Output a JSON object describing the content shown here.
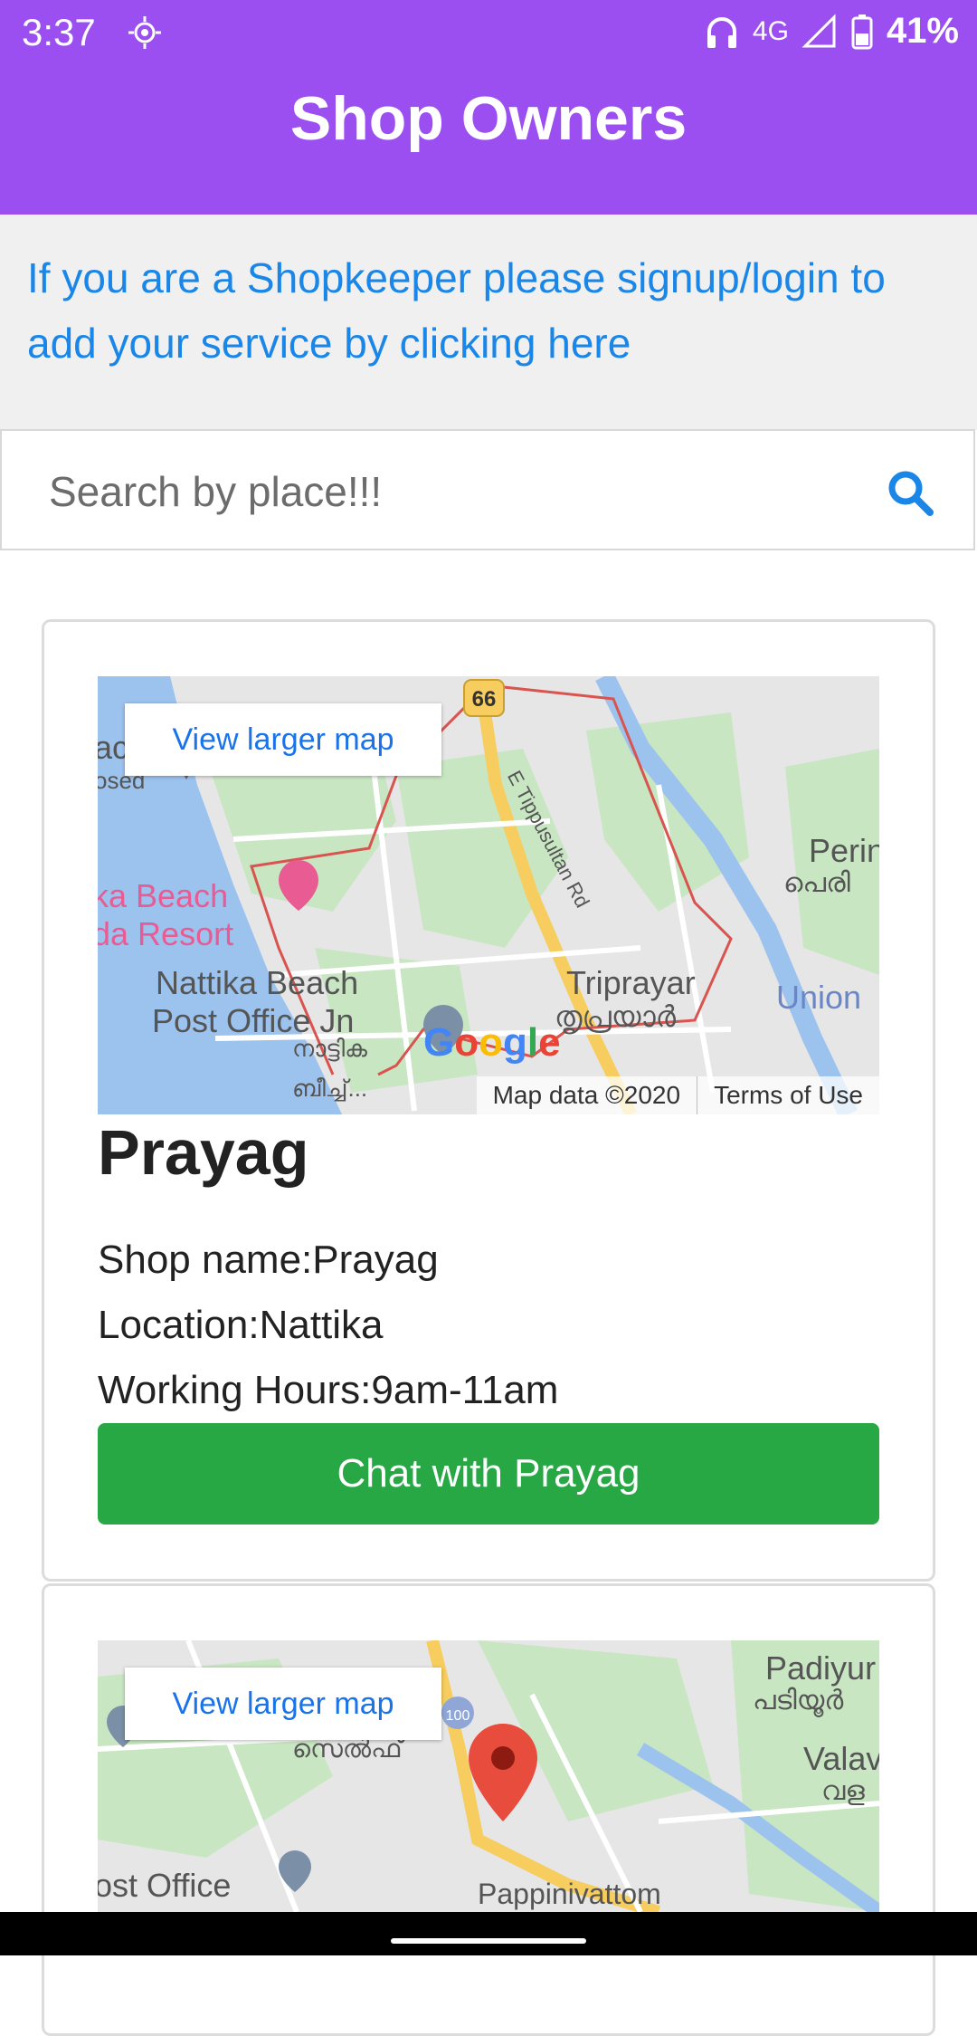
{
  "status": {
    "time": "3:37",
    "network": "4G",
    "battery": "41%"
  },
  "header": {
    "title": "Shop Owners"
  },
  "banner": {
    "text": "If you are a Shopkeeper please signup/login to add your service by clicking here"
  },
  "search": {
    "placeholder": "Search by place!!!",
    "value": ""
  },
  "cards": [
    {
      "map": {
        "view_larger": "View larger map",
        "attribution": "Map data ©2020",
        "terms": "Terms of Use",
        "labels": [
          "66",
          "E Tippusultan Rd",
          "ka Beach",
          "da Resort",
          "Nattika Beach",
          "Post Office Jn",
          "Triprayar",
          "തൃപ്രയാർ",
          "നാട്ടിക",
          "ബീച്ച്...",
          "Perin",
          "പെരി",
          "Union",
          "osed",
          "ac"
        ]
      },
      "title": "Prayag",
      "shop_name": "Shop name:Prayag",
      "location": "Location:Nattika",
      "hours": "Working Hours:9am-11am",
      "chat_label": "Chat with Prayag"
    },
    {
      "map": {
        "view_larger": "View larger map",
        "labels": [
          "Padiyur",
          "പടിയൂർ",
          "Valav",
          "വള",
          "സെൽഫ്",
          "ost Office",
          "Pappinivattom",
          "100"
        ]
      }
    }
  ],
  "colors": {
    "header": "#9b4ff0",
    "link": "#1a86e8",
    "chat_button": "#28a745"
  }
}
